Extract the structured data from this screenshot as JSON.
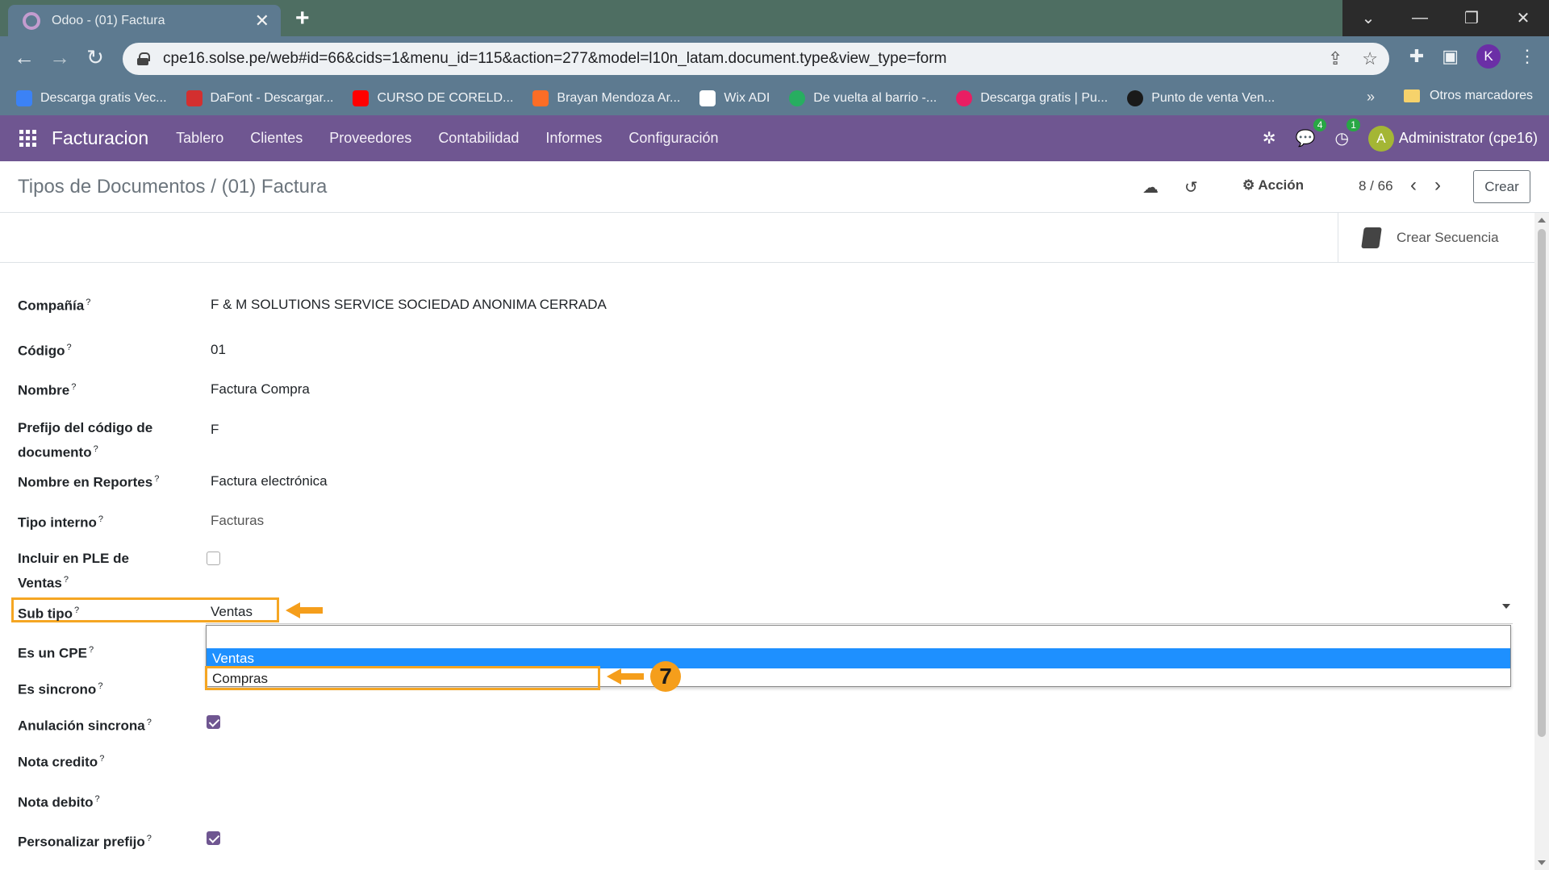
{
  "browser": {
    "tab_title": "Odoo - (01) Factura",
    "url": "cpe16.solse.pe/web#id=66&cids=1&menu_id=115&action=277&model=l10n_latam.document.type&view_type=form",
    "profile_initial": "K",
    "bookmarks": [
      {
        "label": "Descarga gratis Vec...",
        "color": "#3b82f6"
      },
      {
        "label": "DaFont - Descargar...",
        "color": "#d32f2f"
      },
      {
        "label": "CURSO DE CORELD...",
        "color": "#ff0000"
      },
      {
        "label": "Brayan Mendoza Ar...",
        "color": "#fc6d26"
      },
      {
        "label": "Wix ADI",
        "color": "#ffffff"
      },
      {
        "label": "De vuelta al barrio -...",
        "color": "#27ae60"
      },
      {
        "label": "Descarga gratis | Pu...",
        "color": "#e91e63"
      },
      {
        "label": "Punto de venta Ven...",
        "color": "#1a1a1a"
      }
    ],
    "bookmarks_more": "»",
    "other_bookmarks": "Otros marcadores"
  },
  "nav": {
    "brand": "Facturacion",
    "menu": [
      "Tablero",
      "Clientes",
      "Proveedores",
      "Contabilidad",
      "Informes",
      "Configuración"
    ],
    "chat_count": "4",
    "activity_count": "1",
    "user_initial": "A",
    "user_name": "Administrator (cpe16)"
  },
  "control": {
    "breadcrumb_parent": "Tipos de Documentos",
    "breadcrumb_sep": "/",
    "breadcrumb_current": "(01) Factura",
    "action_label": "Acción",
    "pager": "8 / 66",
    "create_label": "Crear"
  },
  "form": {
    "sequence_button": "Crear Secuencia",
    "help_mark": "?",
    "fields": {
      "company": {
        "label": "Compañía",
        "value": "F & M SOLUTIONS SERVICE SOCIEDAD ANONIMA CERRADA"
      },
      "code": {
        "label": "Código",
        "value": "01"
      },
      "name": {
        "label": "Nombre",
        "value": "Factura Compra"
      },
      "prefix_l1": "Prefijo del código de",
      "prefix_l2": "documento",
      "prefix_value": "F",
      "report_name": {
        "label": "Nombre en Reportes",
        "value": "Factura electrónica"
      },
      "internal_type": {
        "label": "Tipo interno",
        "value": "Facturas"
      },
      "ple_l1": "Incluir en PLE de",
      "ple_l2": "Ventas",
      "ple_checked": false,
      "subtype": {
        "label": "Sub tipo",
        "value": "Ventas"
      },
      "is_cpe": {
        "label": "Es un CPE"
      },
      "sync": {
        "label": "Es sincrono"
      },
      "sync_cancel": {
        "label": "Anulación sincrona",
        "checked": true
      },
      "credit_note": {
        "label": "Nota credito"
      },
      "debit_note": {
        "label": "Nota debito"
      },
      "custom_prefix": {
        "label": "Personalizar prefijo",
        "checked": true
      }
    },
    "dropdown_options": [
      "Ventas",
      "Compras"
    ]
  },
  "annotation": {
    "step": "7",
    "color": "#f59e1b"
  }
}
